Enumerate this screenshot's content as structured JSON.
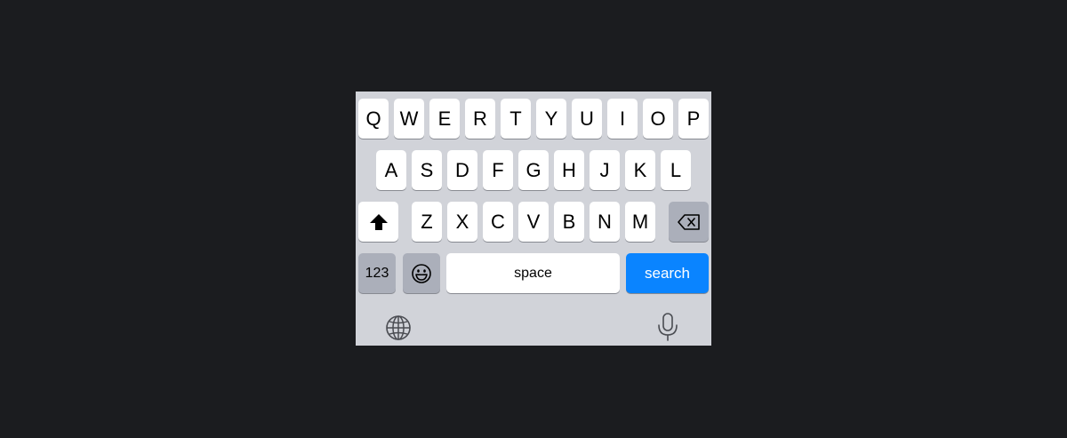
{
  "keyboard": {
    "row1": [
      "Q",
      "W",
      "E",
      "R",
      "T",
      "Y",
      "U",
      "I",
      "O",
      "P"
    ],
    "row2": [
      "A",
      "S",
      "D",
      "F",
      "G",
      "H",
      "J",
      "K",
      "L"
    ],
    "row3": [
      "Z",
      "X",
      "C",
      "V",
      "B",
      "N",
      "M"
    ],
    "numbers_label": "123",
    "space_label": "space",
    "search_label": "search"
  },
  "icons": {
    "shift": "shift-icon",
    "backspace": "backspace-icon",
    "emoji": "emoji-icon",
    "globe": "globe-icon",
    "mic": "microphone-icon"
  },
  "colors": {
    "keyboard_bg": "#d1d3d9",
    "key_bg": "#ffffff",
    "dark_key_bg": "#abafba",
    "accent": "#0a84ff",
    "page_bg": "#1b1c1f"
  }
}
